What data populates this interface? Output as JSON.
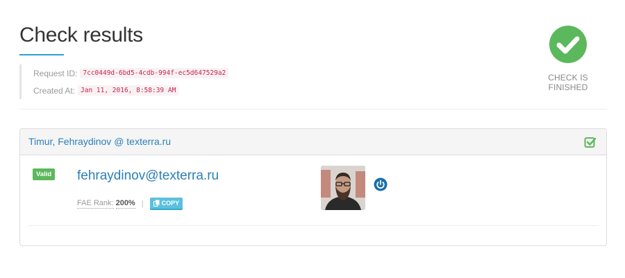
{
  "header": {
    "title": "Check results",
    "request_id_label": "Request ID:",
    "request_id": "7cc0449d-6bd5-4cdb-994f-ec5d647529a2",
    "created_at_label": "Created At:",
    "created_at": "Jan 11, 2016, 8:58:39 AM"
  },
  "status": {
    "text": "CHECK IS FINISHED",
    "icon": "check-circle-icon",
    "color": "#5cb85c"
  },
  "result": {
    "title": "Timur, Fehraydinov @ texterra.ru",
    "badge": "Valid",
    "email": "fehraydinov@texterra.ru",
    "rank_label": "FAE Rank:",
    "rank_value": "200%",
    "separator": "|",
    "copy_label": "COPY",
    "icons": [
      "checkbox-checked-icon",
      "copy-icon",
      "power-icon"
    ],
    "avatar": "profile-photo"
  },
  "colors": {
    "accent": "#2a9fd6",
    "link": "#2a7fb8",
    "valid": "#5cb85c",
    "copy": "#5bc0de",
    "power": "#1b6fa8"
  }
}
